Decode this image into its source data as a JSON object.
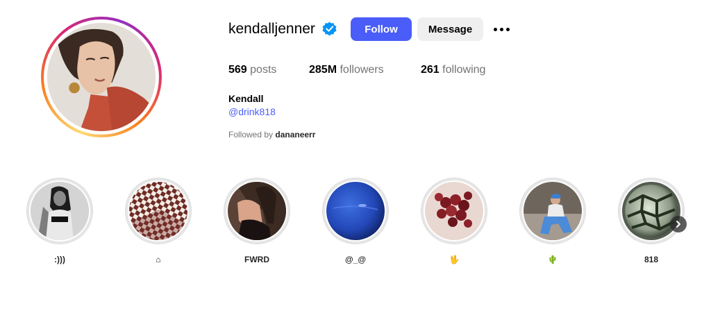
{
  "profile": {
    "username": "kendalljenner",
    "verified": true,
    "follow_label": "Follow",
    "message_label": "Message",
    "more_label": "More options",
    "full_name": "Kendall",
    "link_text": "@drink818",
    "followed_by_prefix": "Followed by",
    "followed_by_user": "dananeerr"
  },
  "stats": {
    "posts_count": "569",
    "posts_label": "posts",
    "followers_count": "285M",
    "followers_label": "followers",
    "following_count": "261",
    "following_label": "following"
  },
  "highlights": [
    {
      "label": ":)))",
      "icon": "bw-portrait"
    },
    {
      "label": "⌂",
      "icon": "checker-room"
    },
    {
      "label": "FWRD",
      "icon": "woman-dark"
    },
    {
      "label": "@_@",
      "icon": "neptune"
    },
    {
      "label": "🖖",
      "icon": "grapes"
    },
    {
      "label": "🌵",
      "icon": "sitting-person"
    },
    {
      "label": "818",
      "icon": "glass-orb"
    }
  ],
  "colors": {
    "accent": "#4a5df9",
    "verified_badge": "#0095f6",
    "secondary_button": "#efefef",
    "muted_text": "#737373"
  }
}
